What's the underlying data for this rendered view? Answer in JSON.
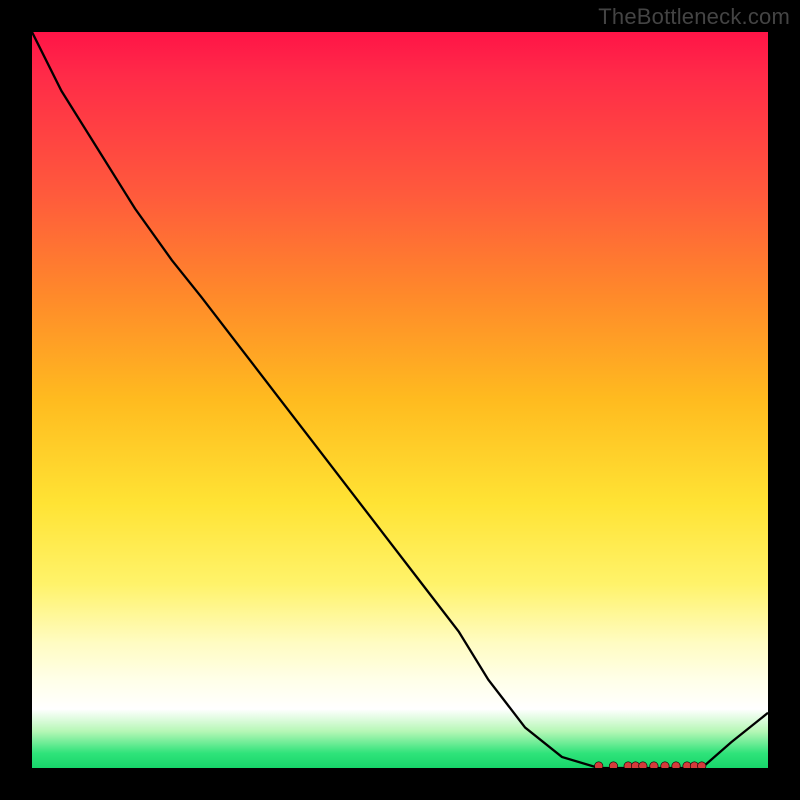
{
  "attribution": "TheBottleneck.com",
  "chart_data": {
    "type": "line",
    "x": [
      0.0,
      0.04,
      0.09,
      0.14,
      0.19,
      0.23,
      0.28,
      0.33,
      0.38,
      0.43,
      0.48,
      0.53,
      0.58,
      0.62,
      0.67,
      0.72,
      0.77,
      0.79,
      0.81,
      0.83,
      0.85,
      0.87,
      0.89,
      0.91,
      0.95,
      1.0
    ],
    "values": [
      100,
      92,
      84,
      76,
      69,
      64,
      57.5,
      51,
      44.5,
      38,
      31.5,
      25,
      18.5,
      12,
      5.5,
      1.5,
      0,
      0,
      0,
      0,
      0,
      0,
      0,
      0,
      3.5,
      7.5
    ],
    "marker_x": [
      0.77,
      0.79,
      0.81,
      0.82,
      0.83,
      0.845,
      0.86,
      0.875,
      0.89,
      0.9,
      0.91
    ],
    "title": "",
    "xlabel": "",
    "ylabel": "",
    "xlim": [
      0,
      1
    ],
    "ylim": [
      0,
      100
    ],
    "legend": false,
    "grid": false,
    "background": "heat-gradient",
    "colors": {
      "top": "#ff1447",
      "mid": "#ffe334",
      "bottom": "#17d56a",
      "line": "#000000",
      "marker": "#d43b3b"
    }
  }
}
